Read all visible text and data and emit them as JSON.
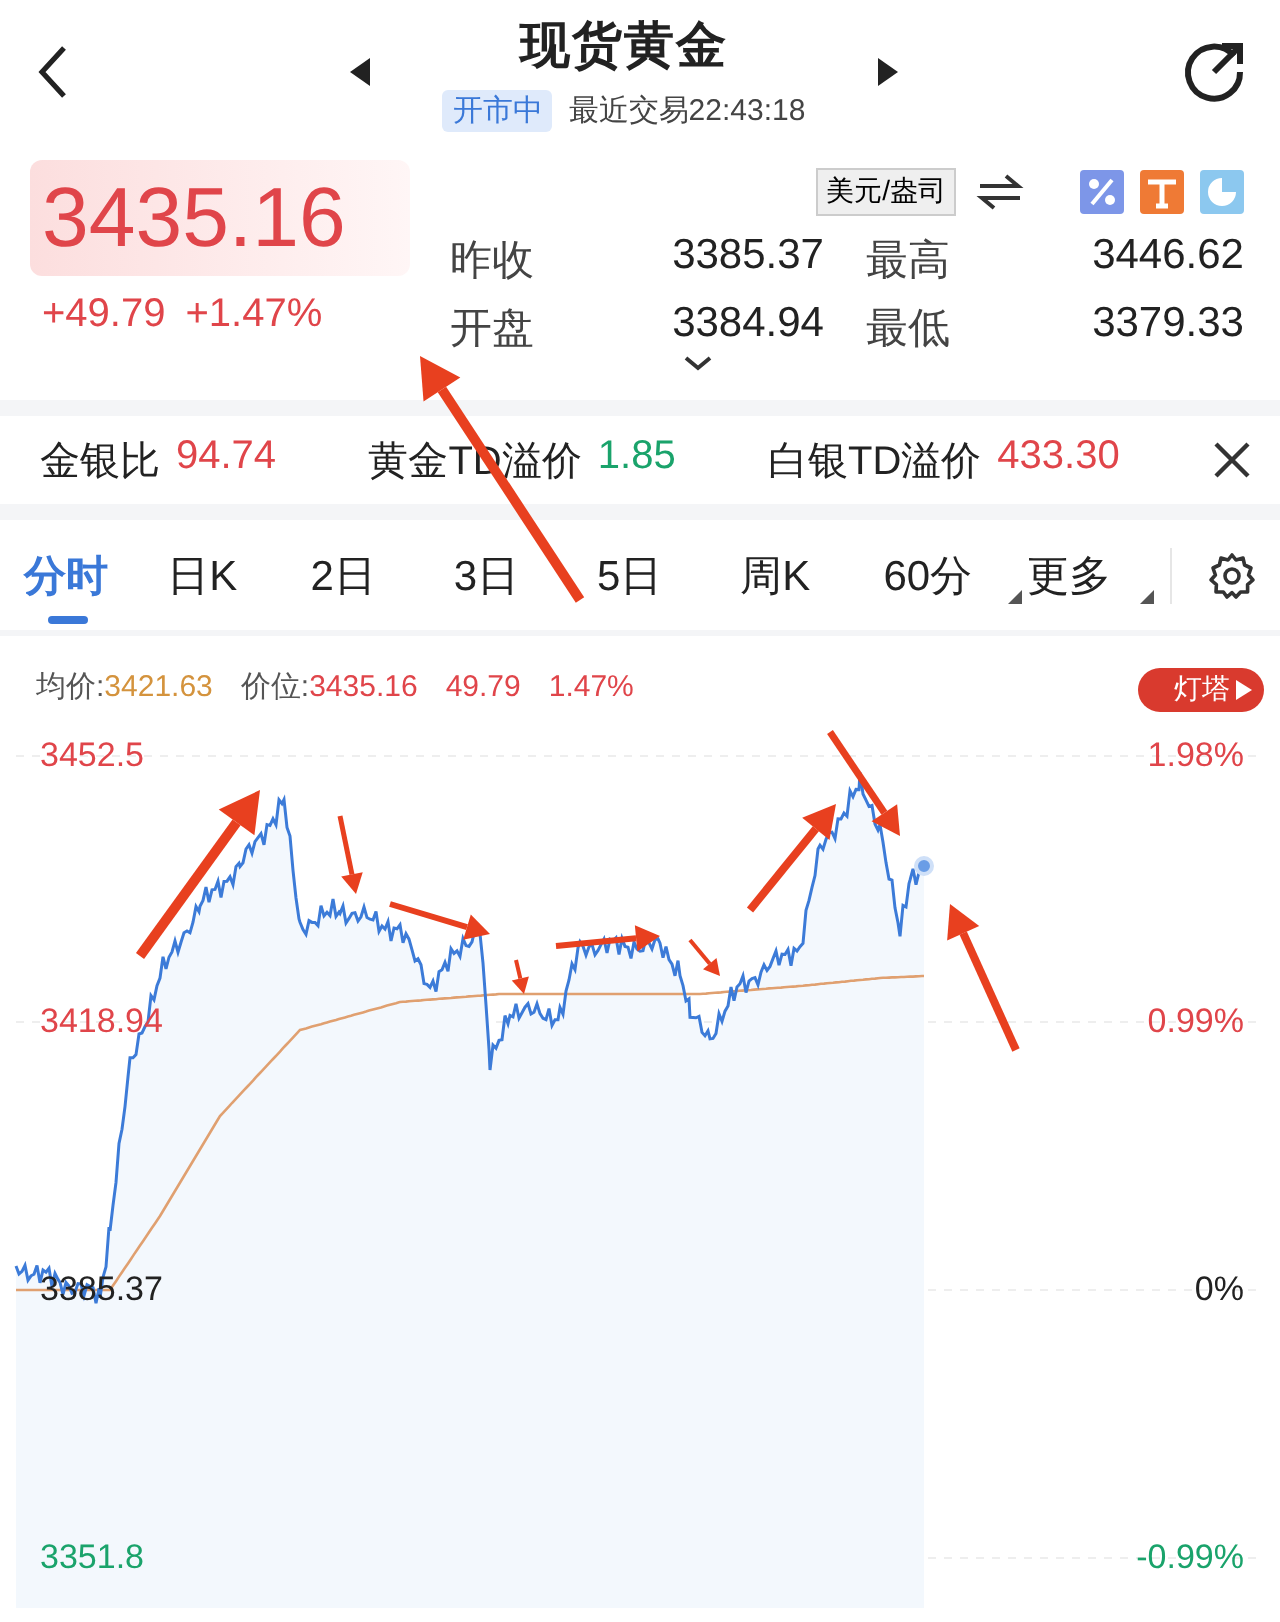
{
  "header": {
    "title": "现货黄金",
    "status": "开市中",
    "last_trade": "最近交易22:43:18"
  },
  "quote": {
    "price": "3435.16",
    "change": "+49.79",
    "change_pct": "+1.47%",
    "unit": "美元/盎司",
    "stats": [
      {
        "label": "昨收",
        "value": "3385.37"
      },
      {
        "label": "最高",
        "value": "3446.62"
      },
      {
        "label": "开盘",
        "value": "3384.94"
      },
      {
        "label": "最低",
        "value": "3379.33"
      }
    ]
  },
  "ticker": [
    {
      "label": "金银比",
      "value": "94.74",
      "color": "#e0454a"
    },
    {
      "label": "黄金TD溢价",
      "value": "1.85",
      "color": "#1aa36b"
    },
    {
      "label": "白银TD溢价",
      "value": "433.30",
      "color": "#e0454a"
    }
  ],
  "tabs": [
    {
      "label": "分时",
      "selected": true,
      "menu": false
    },
    {
      "label": "日K",
      "selected": false,
      "menu": false
    },
    {
      "label": "2日",
      "selected": false,
      "menu": false
    },
    {
      "label": "3日",
      "selected": false,
      "menu": false
    },
    {
      "label": "5日",
      "selected": false,
      "menu": false
    },
    {
      "label": "周K",
      "selected": false,
      "menu": false
    },
    {
      "label": "60分",
      "selected": false,
      "menu": true
    },
    {
      "label": "更多",
      "selected": false,
      "menu": true
    }
  ],
  "chart": {
    "info": [
      {
        "label": "均价:",
        "value": "3421.63",
        "kind": "avg"
      },
      {
        "label": "价位:",
        "value": "3435.16",
        "kind": "price"
      }
    ],
    "change": "49.79",
    "change_pct": "1.47%",
    "badge": "灯塔",
    "left_ticks": [
      {
        "label": "3452.5",
        "color": "#e0454a"
      },
      {
        "label": "3418.94",
        "color": "#e0454a"
      },
      {
        "label": "3385.37",
        "color": "#222222"
      },
      {
        "label": "3351.8",
        "color": "#1aa36b"
      }
    ],
    "right_ticks": [
      {
        "label": "1.98%",
        "color": "#e0454a"
      },
      {
        "label": "0.99%",
        "color": "#e0454a"
      },
      {
        "label": "0%",
        "color": "#222222"
      },
      {
        "label": "-0.99%",
        "color": "#1aa36b"
      }
    ]
  }
}
